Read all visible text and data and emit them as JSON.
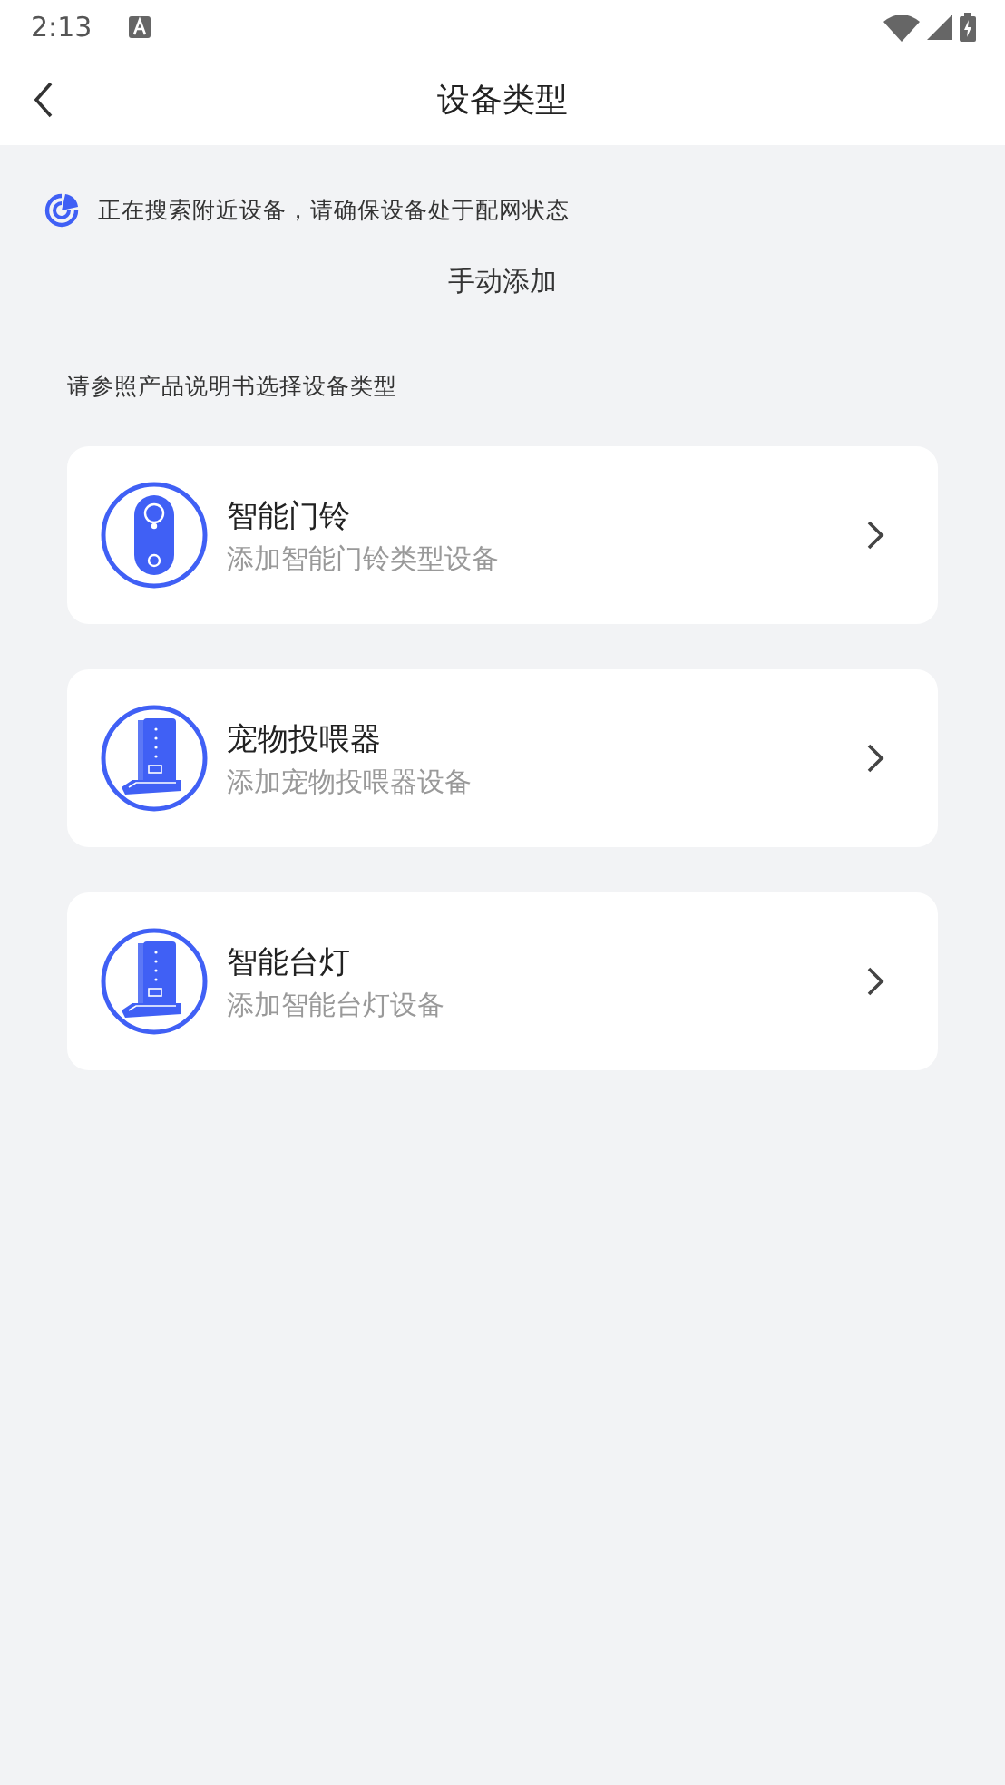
{
  "status_bar": {
    "time": "2:13"
  },
  "header": {
    "title": "设备类型"
  },
  "scan_notice": "正在搜索附近设备，请确保设备处于配网状态",
  "manual_add": "手动添加",
  "hint": "请参照产品说明书选择设备类型",
  "devices": [
    {
      "kind": "doorbell",
      "name": "智能门铃",
      "description": "添加智能门铃类型设备"
    },
    {
      "kind": "feeder",
      "name": "宠物投喂器",
      "description": "添加宠物投喂器设备"
    },
    {
      "kind": "feeder",
      "name": "智能台灯",
      "description": "添加智能台灯设备"
    }
  ]
}
